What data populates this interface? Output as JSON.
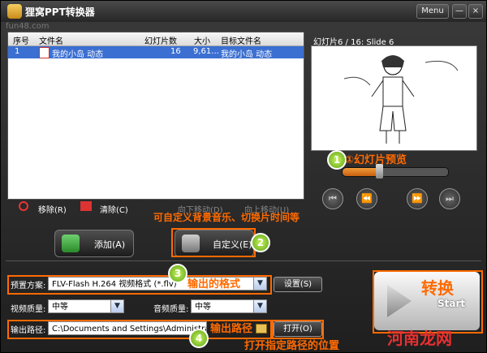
{
  "window": {
    "title": "狸窝PPT转换器",
    "menu_label": "Menu",
    "minimize": "—",
    "close": "×"
  },
  "watermark": "fun48.com",
  "file_list": {
    "columns": [
      "序号",
      "文件名",
      "幻灯片数",
      "大小",
      "目标文件名"
    ],
    "rows": [
      {
        "index": "1",
        "name": "我的小岛 动态",
        "slides": "16",
        "size": "9,61...",
        "target": "我的小岛 动态"
      }
    ]
  },
  "preview": {
    "header": "幻灯片6 / 16: Slide 6",
    "progress_fraction": 0.38
  },
  "actions": {
    "remove": "移除(R)",
    "clear": "清除(C)",
    "move_down": "向下移动(D)",
    "move_up": "向上移动(U)"
  },
  "buttons": {
    "add": "添加(A)",
    "custom": "自定义(E)",
    "settings": "设置(S)",
    "open": "打开(O)",
    "start": "Start",
    "start_cn": "转换"
  },
  "annotations": {
    "a1": "①幻灯片预览",
    "a2": "可自定义背景音乐、切换片时间等",
    "a3": "输出的格式",
    "a4": "输出路径",
    "a5": "打开指定路径的位置"
  },
  "form": {
    "preset_label": "预置方案:",
    "preset_value": "FLV-Flash H.264 视频格式 (*.flv)",
    "video_quality_label": "视频质量:",
    "video_quality_value": "中等",
    "audio_quality_label": "音频质量:",
    "audio_quality_value": "中等",
    "output_label": "输出路径:",
    "output_value": "C:\\Documents and Settings\\Administrator\\桌面"
  },
  "site_watermark": "河南龙网",
  "colors": {
    "accent": "#ff6a00",
    "selection": "#3b6fd1"
  }
}
